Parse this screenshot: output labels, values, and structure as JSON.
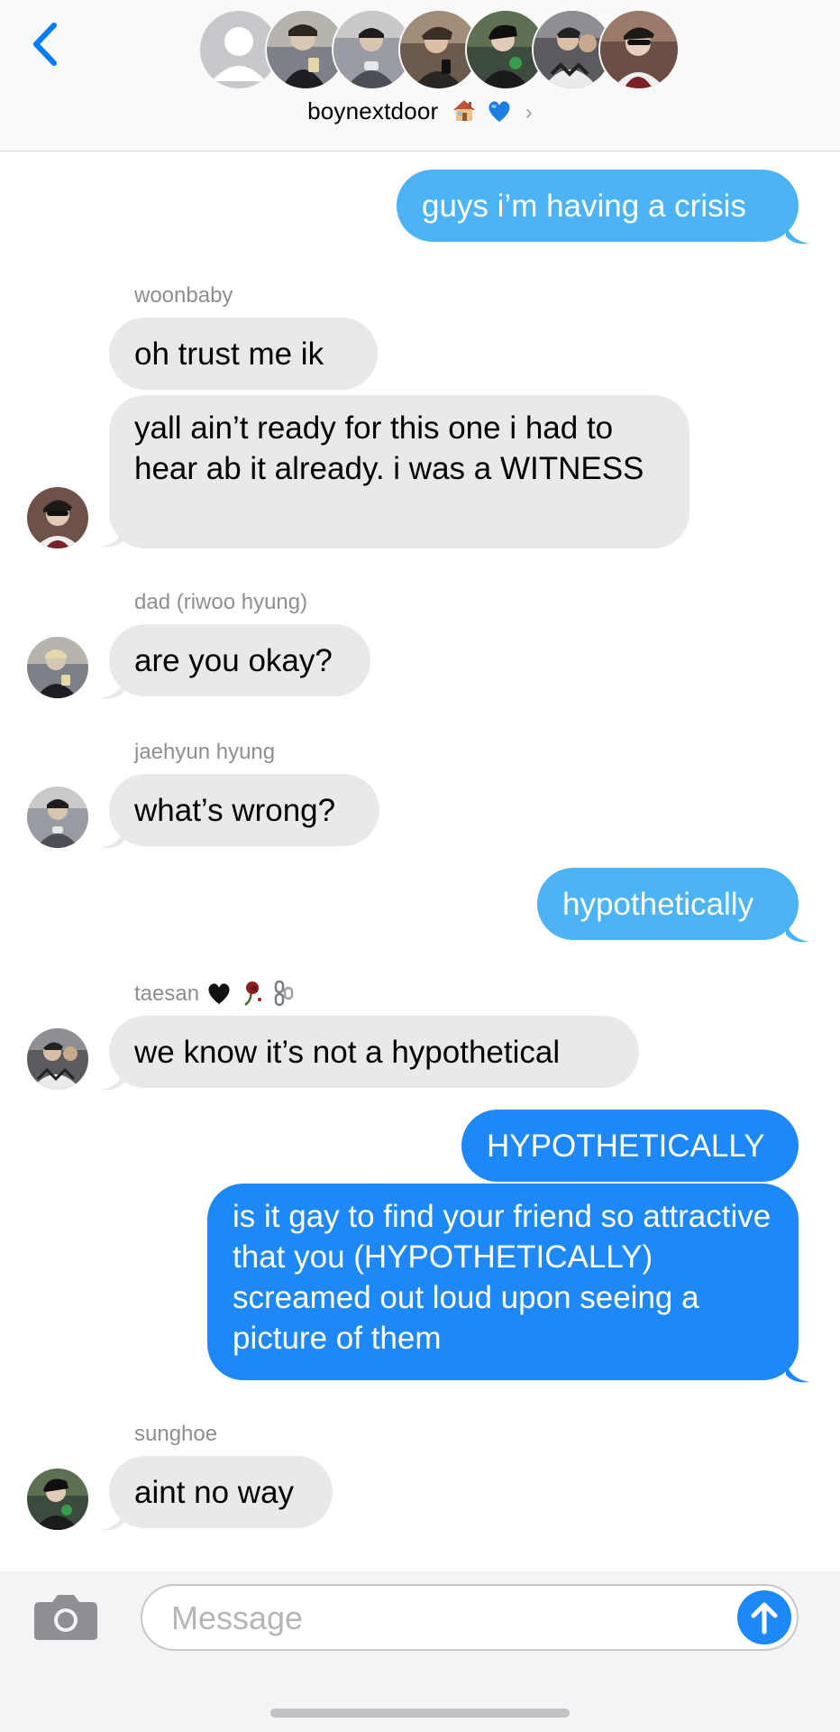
{
  "header": {
    "back_icon": "chevron-left-icon",
    "group_name": "boynextdoor",
    "name_emojis": [
      "house-emoji",
      "blue-heart-emoji"
    ],
    "chevron": "›",
    "accent_color": "#007aff"
  },
  "messages": [
    {
      "id": "m1",
      "direction": "outgoing",
      "text": "guys i’m having a crisis"
    },
    {
      "id": "m2",
      "direction": "incoming",
      "sender": "woonbaby",
      "text": "oh trust me ik"
    },
    {
      "id": "m3",
      "direction": "incoming",
      "sender": "woonbaby",
      "text": "yall ain’t ready for this one i had to hear ab it already. i was a WITNESS"
    },
    {
      "id": "m4",
      "direction": "incoming",
      "sender": "dad (riwoo hyung)",
      "text": "are you okay?"
    },
    {
      "id": "m5",
      "direction": "incoming",
      "sender": "jaehyun hyung",
      "text": "what’s wrong?"
    },
    {
      "id": "m6",
      "direction": "outgoing",
      "text": "hypothetically"
    },
    {
      "id": "m7",
      "direction": "incoming",
      "sender": "taesan",
      "sender_emojis": [
        "black-heart-emoji",
        "wilted-rose-emoji",
        "chains-emoji"
      ],
      "text": "we know it’s not a hypothetical"
    },
    {
      "id": "m8",
      "direction": "outgoing",
      "text": "HYPOTHETICALLY"
    },
    {
      "id": "m9",
      "direction": "outgoing",
      "text": "is it gay to find your friend so attractive that you (HYPOTHETICALLY) screamed out loud upon seeing a picture of them"
    },
    {
      "id": "m10",
      "direction": "incoming",
      "sender": "sunghoe",
      "text": "aint no way"
    }
  ],
  "compose": {
    "camera_icon": "camera-icon",
    "placeholder": "Message",
    "value": "",
    "send_icon": "arrow-up-icon"
  },
  "colors": {
    "outgoing_light": "#4cb3f5",
    "outgoing_dark": "#1f88f7",
    "incoming": "#e9e9eb",
    "sender_label": "#8e8e93"
  }
}
